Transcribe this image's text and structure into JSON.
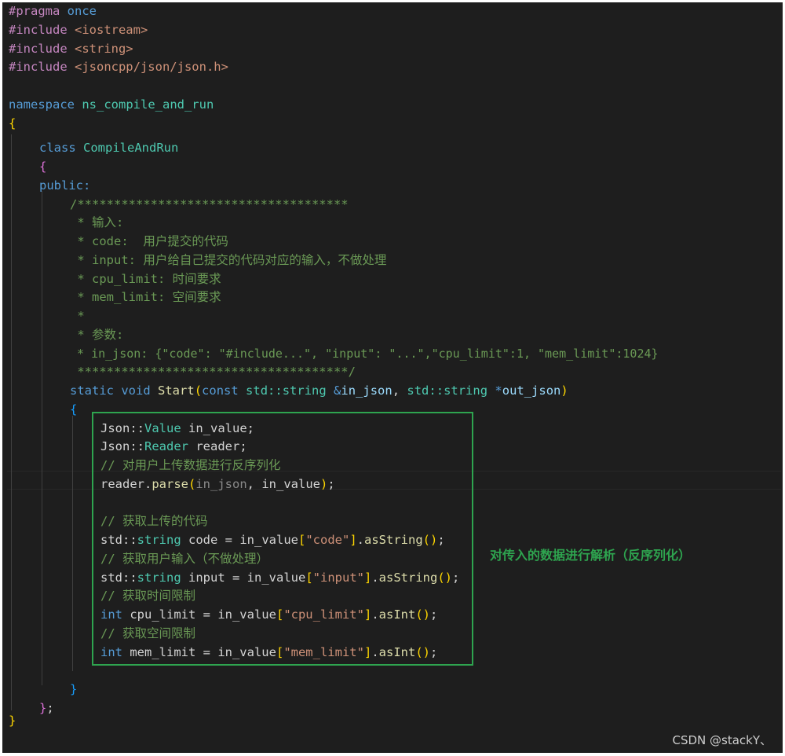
{
  "code": {
    "line1": {
      "p1": "#pragma",
      "p2": " once"
    },
    "line2": {
      "p1": "#include",
      "p2": " <iostream>"
    },
    "line3": {
      "p1": "#include",
      "p2": " <string>"
    },
    "line4": {
      "p1": "#include",
      "p2": " <jsoncpp/json/json.h>"
    },
    "line6": {
      "kw": "namespace",
      "name": " ns_compile_and_run"
    },
    "line7": {
      "brace": "{"
    },
    "line8": {
      "kw": "class",
      "name": "CompileAndRun"
    },
    "line9": {
      "brace": "{"
    },
    "line10": {
      "kw": "public:"
    },
    "line11": {
      "text": "/*************************************"
    },
    "line12": {
      "text": " * 输入:"
    },
    "line13": {
      "text": " * code:  用户提交的代码"
    },
    "line14": {
      "text": " * input: 用户给自己提交的代码对应的输入，不做处理"
    },
    "line15": {
      "text": " * cpu_limit: 时间要求"
    },
    "line16": {
      "text": " * mem_limit: 空间要求"
    },
    "line17": {
      "text": " *"
    },
    "line18": {
      "text": " * 参数:"
    },
    "line19": {
      "text": " * in_json: {\"code\": \"#include...\", \"input\": \"...\",\"cpu_limit\":1, \"mem_limit\":1024}"
    },
    "line20": {
      "text": " *************************************/"
    },
    "line21": {
      "static": "static",
      "void": "void",
      "fn": "Start",
      "open": "(",
      "const": "const",
      "std1": "std::",
      "string1": "string",
      "amp": " &",
      "param1": "in_json",
      "comma": ", ",
      "std2": "std::",
      "string2": "string",
      "star": " *",
      "param2": "out_json",
      "close": ")"
    },
    "line22": {
      "brace": "{"
    },
    "line23": {
      "ns": "Json::",
      "type": "Value",
      "rest": " in_value;"
    },
    "line24": {
      "ns": "Json::",
      "type": "Reader",
      "rest": " reader;"
    },
    "line25": {
      "comment": "// 对用户上传数据进行反序列化"
    },
    "line26": {
      "obj": "reader.",
      "fn": "parse",
      "open": "(",
      "arg1": "in_json",
      "mid": ", in_value",
      "close": ")",
      "semi": ";"
    },
    "line28": {
      "comment": "// 获取上传的代码"
    },
    "line29": {
      "ns": "std::",
      "type": "string",
      "mid": " code = in_value",
      "ob": "[",
      "str": "\"code\"",
      "cb": "]",
      "dot": ".",
      "fn": "asString",
      "paren": "()",
      "semi": ";"
    },
    "line30": {
      "comment": "// 获取用户输入（不做处理）"
    },
    "line31": {
      "ns": "std::",
      "type": "string",
      "mid": " input = in_value",
      "ob": "[",
      "str": "\"input\"",
      "cb": "]",
      "dot": ".",
      "fn": "asString",
      "paren": "()",
      "semi": ";"
    },
    "line32": {
      "comment": "// 获取时间限制"
    },
    "line33": {
      "kw": "int",
      "mid": " cpu_limit = in_value",
      "ob": "[",
      "str": "\"cpu_limit\"",
      "cb": "]",
      "dot": ".",
      "fn": "asInt",
      "paren": "()",
      "semi": ";"
    },
    "line34": {
      "comment": "// 获取空间限制"
    },
    "line35": {
      "kw": "int",
      "mid": " mem_limit = in_value",
      "ob": "[",
      "str": "\"mem_limit\"",
      "cb": "]",
      "dot": ".",
      "fn": "asInt",
      "paren": "()",
      "semi": ";"
    },
    "line37": {
      "brace": "}"
    },
    "line38": {
      "brace": "}",
      "semi": ";"
    },
    "line39": {
      "brace": "}"
    }
  },
  "annotation": {
    "text": "对传入的数据进行解析（反序列化）"
  },
  "watermark": {
    "text": "CSDN @stackY、"
  },
  "colors": {
    "background": "#1e1e1e",
    "keyword": "#569cd6",
    "preprocessor": "#c586c0",
    "class": "#4ec9b0",
    "function": "#dcdcaa",
    "string": "#ce9178",
    "comment": "#6a9955",
    "highlight_box": "#2ea44f"
  }
}
